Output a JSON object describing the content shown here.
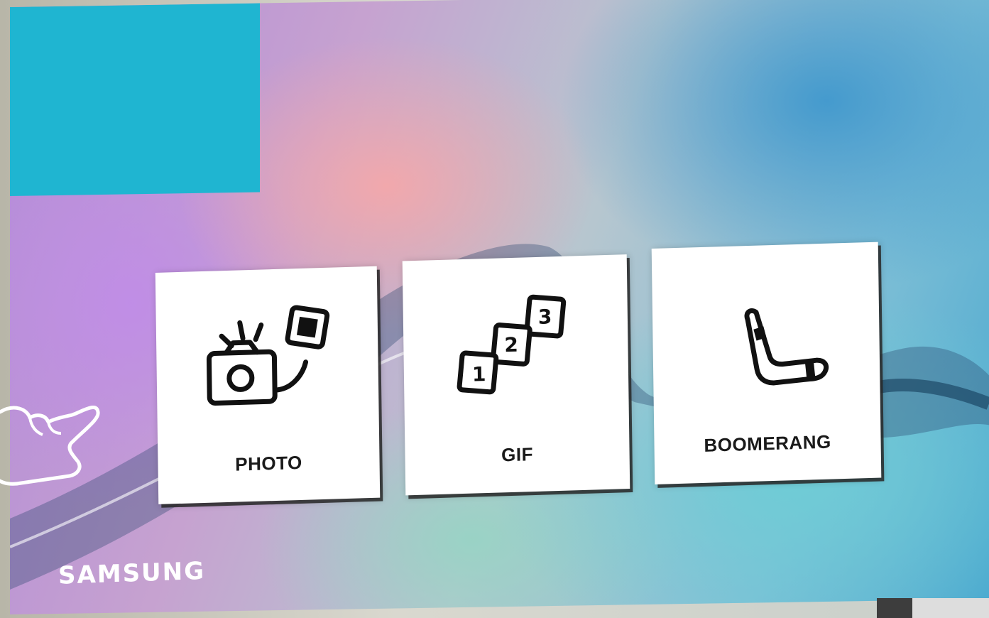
{
  "brand": {
    "name": "SAMSUNG"
  },
  "options": [
    {
      "id": "photo",
      "label": "PHOTO",
      "icon": "camera-photo-icon"
    },
    {
      "id": "gif",
      "label": "GIF",
      "icon": "numbered-frames-icon"
    },
    {
      "id": "boomerang",
      "label": "BOOMERANG",
      "icon": "boomerang-icon"
    }
  ],
  "colors": {
    "panel": "#1fb5d1",
    "tile": "#ffffff",
    "icon_stroke": "#111111",
    "brand_text": "#ffffff"
  }
}
